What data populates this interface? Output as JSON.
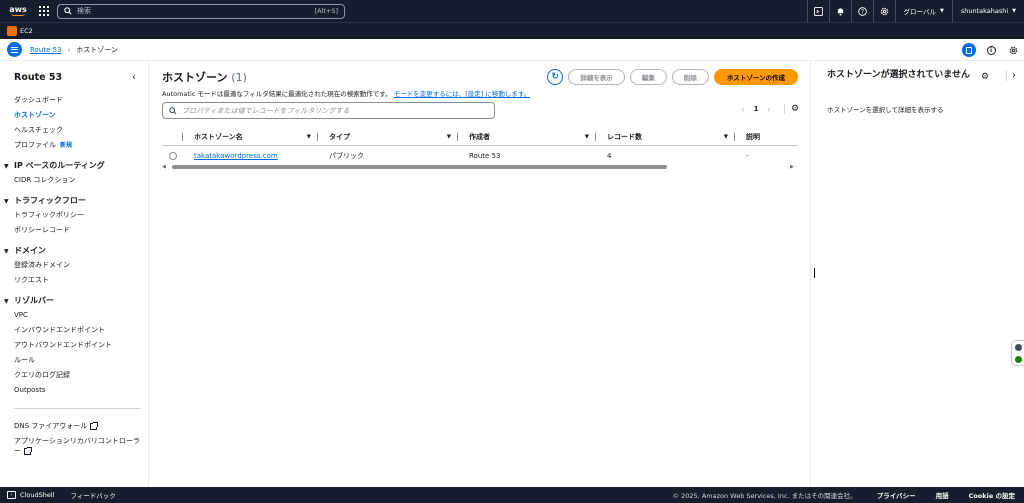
{
  "topnav": {
    "logo_text": "aws",
    "search_placeholder": "検索",
    "search_shortcut": "[Alt+S]",
    "region": "グローバル",
    "account": "shuntakahashi"
  },
  "servicebar": {
    "ec2_label": "EC2"
  },
  "breadcrumb": {
    "root": "Route 53",
    "current": "ホストゾーン"
  },
  "sidebar": {
    "title": "Route 53",
    "items": [
      "ダッシュボード",
      "ホストゾーン",
      "ヘルスチェック"
    ],
    "profiles_label": "プロファイル",
    "new_badge": "新規",
    "ip_routing": {
      "title": "IP ベースのルーティング",
      "items": [
        "CIDR コレクション"
      ]
    },
    "traffic_flow": {
      "title": "トラフィックフロー",
      "items": [
        "トラフィックポリシー",
        "ポリシーレコード"
      ]
    },
    "domains": {
      "title": "ドメイン",
      "items": [
        "登録済みドメイン",
        "リクエスト"
      ]
    },
    "resolver": {
      "title": "リゾルバー",
      "items": [
        "VPC",
        "インバウンドエンドポイント",
        "アウトバウンドエンドポイント",
        "ルール",
        "クエリのログ記録",
        "Outposts"
      ]
    },
    "dns_firewall": "DNS ファイアウォール",
    "arc": "アプリケーションリカバリコントローラー"
  },
  "main": {
    "title": "ホストゾーン",
    "count": "(1)",
    "description": "Automatic モードは最適なフィルタ結果に最適化された現在の検索動作です。",
    "description_link": "モードを変更するには、[設定] に移動します。",
    "buttons": {
      "details": "詳細を表示",
      "edit": "編集",
      "delete": "削除",
      "create": "ホストゾーンの作成"
    },
    "filter_placeholder": "プロパティまたは値でレコードをフィルタリングする",
    "page": "1",
    "columns": [
      "ホストゾーン名",
      "タイプ",
      "作成者",
      "レコード数",
      "説明"
    ],
    "rows": [
      {
        "name": "takatakawordpress.com",
        "type": "パブリック",
        "created_by": "Route 53",
        "records": "4",
        "description": "-"
      }
    ]
  },
  "right_panel": {
    "title": "ホストゾーンが選択されていません",
    "body": "ホストゾーンを選択して詳細を表示する"
  },
  "footer": {
    "cloudshell": "CloudShell",
    "feedback": "フィードバック",
    "copyright": "© 2025, Amazon Web Services, Inc. またはその関連会社。",
    "privacy": "プライバシー",
    "terms": "用語",
    "cookies": "Cookie の設定"
  }
}
